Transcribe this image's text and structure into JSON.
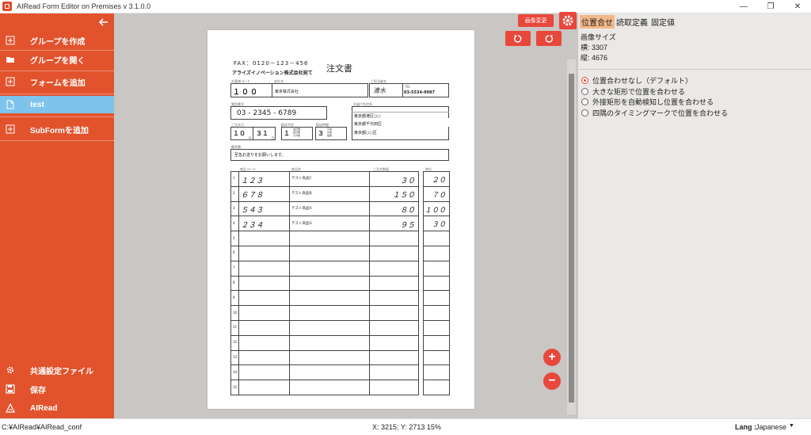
{
  "window": {
    "title": "AIRead Form Editor on Premises v 3.1.0.0",
    "minimize": "—",
    "restore": "❐",
    "close": "✕"
  },
  "sidebar": {
    "items": [
      {
        "label": "グループを作成"
      },
      {
        "label": "グループを開く"
      },
      {
        "label": "フォームを追加"
      },
      {
        "label": "test"
      },
      {
        "label": "SubFormを追加"
      }
    ],
    "bottom": [
      {
        "label": "共通設定ファイル"
      },
      {
        "label": "保存"
      },
      {
        "label": "AIRead"
      }
    ]
  },
  "toolbar": {
    "image_change": "画像変更",
    "settings_caption": "設定"
  },
  "zoom": {
    "plus": "+",
    "minus": "−"
  },
  "right_panel": {
    "tabs": [
      "位置合せ",
      "読取定義",
      "固定値"
    ],
    "image_size": {
      "title": "画像サイズ",
      "width": "横: 3307",
      "height": "縦: 4676"
    },
    "options": [
      "位置合わせなし（デフォルト）",
      "大きな矩形で位置を合わせる",
      "外接矩形を自動検知し位置を合わせる",
      "四隅のタイミングマークで位置を合わせる"
    ]
  },
  "status": {
    "path": "C:¥AIRead¥AIRead_conf",
    "coords": "X: 3215; Y: 2713   15%",
    "lang_label": "Lang :",
    "lang_value": "Japanese",
    "lang_caret": "▼"
  },
  "form": {
    "fax": "FAX：0120－123－456",
    "title": "注文書",
    "company": "アライズイノベーション株式会社宛て",
    "labels": {
      "customer_code": "お客様コード",
      "company_name": "会社名",
      "person": "ご担当者名",
      "tel": "TEL",
      "phone": "電話番号",
      "address": "お届け先住所",
      "order_date": "ご注文日",
      "ship_date": "配送予定",
      "delivery": "配送時間",
      "note": "備考欄",
      "product_code": "商品コード",
      "product_name": "商品名",
      "quantity": "ご注文数量",
      "unit": "単位"
    },
    "customer_code": "１００",
    "company_name": "東京株式会社",
    "person": "清水",
    "tel": "03-5534-9987",
    "phone": "03 - 2345 - 6789",
    "address_1": "東京都港区○○",
    "address_2": "東京都千代田区",
    "address_3": "東京都○○区",
    "month": "１０",
    "month_unit": "月",
    "day": "３１",
    "day_unit": "日",
    "ship_num": "１",
    "ship_options": [
      "当日便",
      "翌日便",
      "その他"
    ],
    "delivery_num": "３",
    "delivery_options": [
      "午前",
      "午後",
      "夜間"
    ],
    "note_text": "至急お送りをお願いします。",
    "rows": [
      {
        "no": "1",
        "code": "１２３",
        "name": "テスト商品C",
        "qty": "３０",
        "unit": "２０"
      },
      {
        "no": "2",
        "code": "６７８",
        "name": "テスト商品B",
        "qty": "１５０",
        "unit": "７０"
      },
      {
        "no": "3",
        "code": "５４３",
        "name": "テスト商品A",
        "qty": "８０",
        "unit": "１００"
      },
      {
        "no": "4",
        "code": "２３４",
        "name": "テスト商品G",
        "qty": "９５",
        "unit": "３０"
      },
      {
        "no": "5"
      },
      {
        "no": "6"
      },
      {
        "no": "7"
      },
      {
        "no": "8"
      },
      {
        "no": "9"
      },
      {
        "no": "10"
      },
      {
        "no": "11"
      },
      {
        "no": "12"
      },
      {
        "no": "13"
      },
      {
        "no": "14"
      },
      {
        "no": "15"
      }
    ]
  }
}
